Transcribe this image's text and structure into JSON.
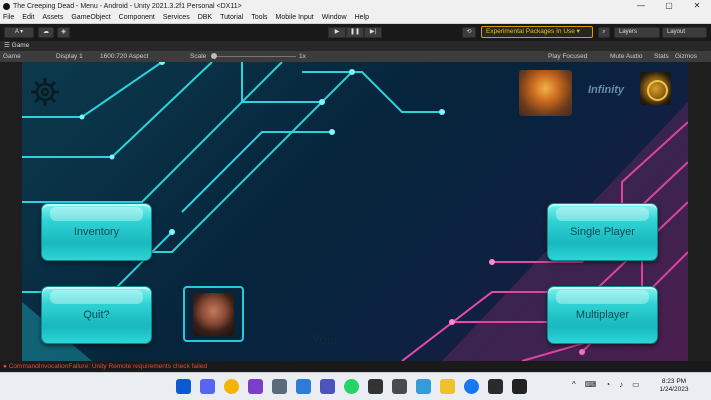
{
  "window": {
    "title": "The Creeping Dead - Menu - Android - Unity 2021.3.2f1 Personal <DX11>",
    "controls": [
      "—",
      "▢",
      "✕"
    ]
  },
  "menubar": [
    "File",
    "Edit",
    "Assets",
    "GameObject",
    "Component",
    "Services",
    "DBK",
    "Tutorial",
    "Tools",
    "Mobile Input",
    "Window",
    "Help"
  ],
  "toolbar": {
    "account": "A ▾",
    "experimental": "Experimental Packages In Use ▾",
    "layers": "Layers",
    "layout": "Layout",
    "play": "▶",
    "pause": "❚❚",
    "step": "▶|",
    "history_icon": "history-icon",
    "search_icon": "search-icon"
  },
  "tab": {
    "label": "Game"
  },
  "gamebar": {
    "view": "Game",
    "display": "Display 1",
    "aspect": "1600:720 Aspect",
    "scale_label": "Scale",
    "scale_value": "1x",
    "play_focused": "Play Focused",
    "mute": "Mute Audio",
    "stats": "Stats",
    "gizmos": "Gizmos"
  },
  "game": {
    "infinity": "Infinity",
    "buttons": {
      "inventory": "Inventory",
      "quit": "Quit?",
      "single_player": "Single Player",
      "multiplayer": "Multiplayer"
    },
    "footer_text": "Your …",
    "settings_icon": "gear-icon"
  },
  "console": {
    "message": "CommandInvocationFailure: Unity Remote requirements check failed"
  },
  "taskbar": {
    "time": "8:23 PM",
    "date": "1/24/2023",
    "icons": [
      "windows",
      "discord",
      "chrome",
      "visual-studio",
      "settings",
      "photos",
      "teams",
      "whatsapp",
      "unity",
      "calculator",
      "maps",
      "file-explorer",
      "facebook",
      "terminal",
      "unity-hub"
    ],
    "colors": [
      "#0a5ad4",
      "#5865f2",
      "#f4b400",
      "#7a3fc8",
      "#5a6a7a",
      "#2d7bd6",
      "#4b53bc",
      "#25d366",
      "#333333",
      "#4a4a4a",
      "#2f9ed8",
      "#f0c22a",
      "#1877f2",
      "#2b2b2b",
      "#222222"
    ]
  },
  "colors": {
    "button_fill": "#30d3d4",
    "warning": "#f0c000",
    "error": "#e24a3a"
  }
}
